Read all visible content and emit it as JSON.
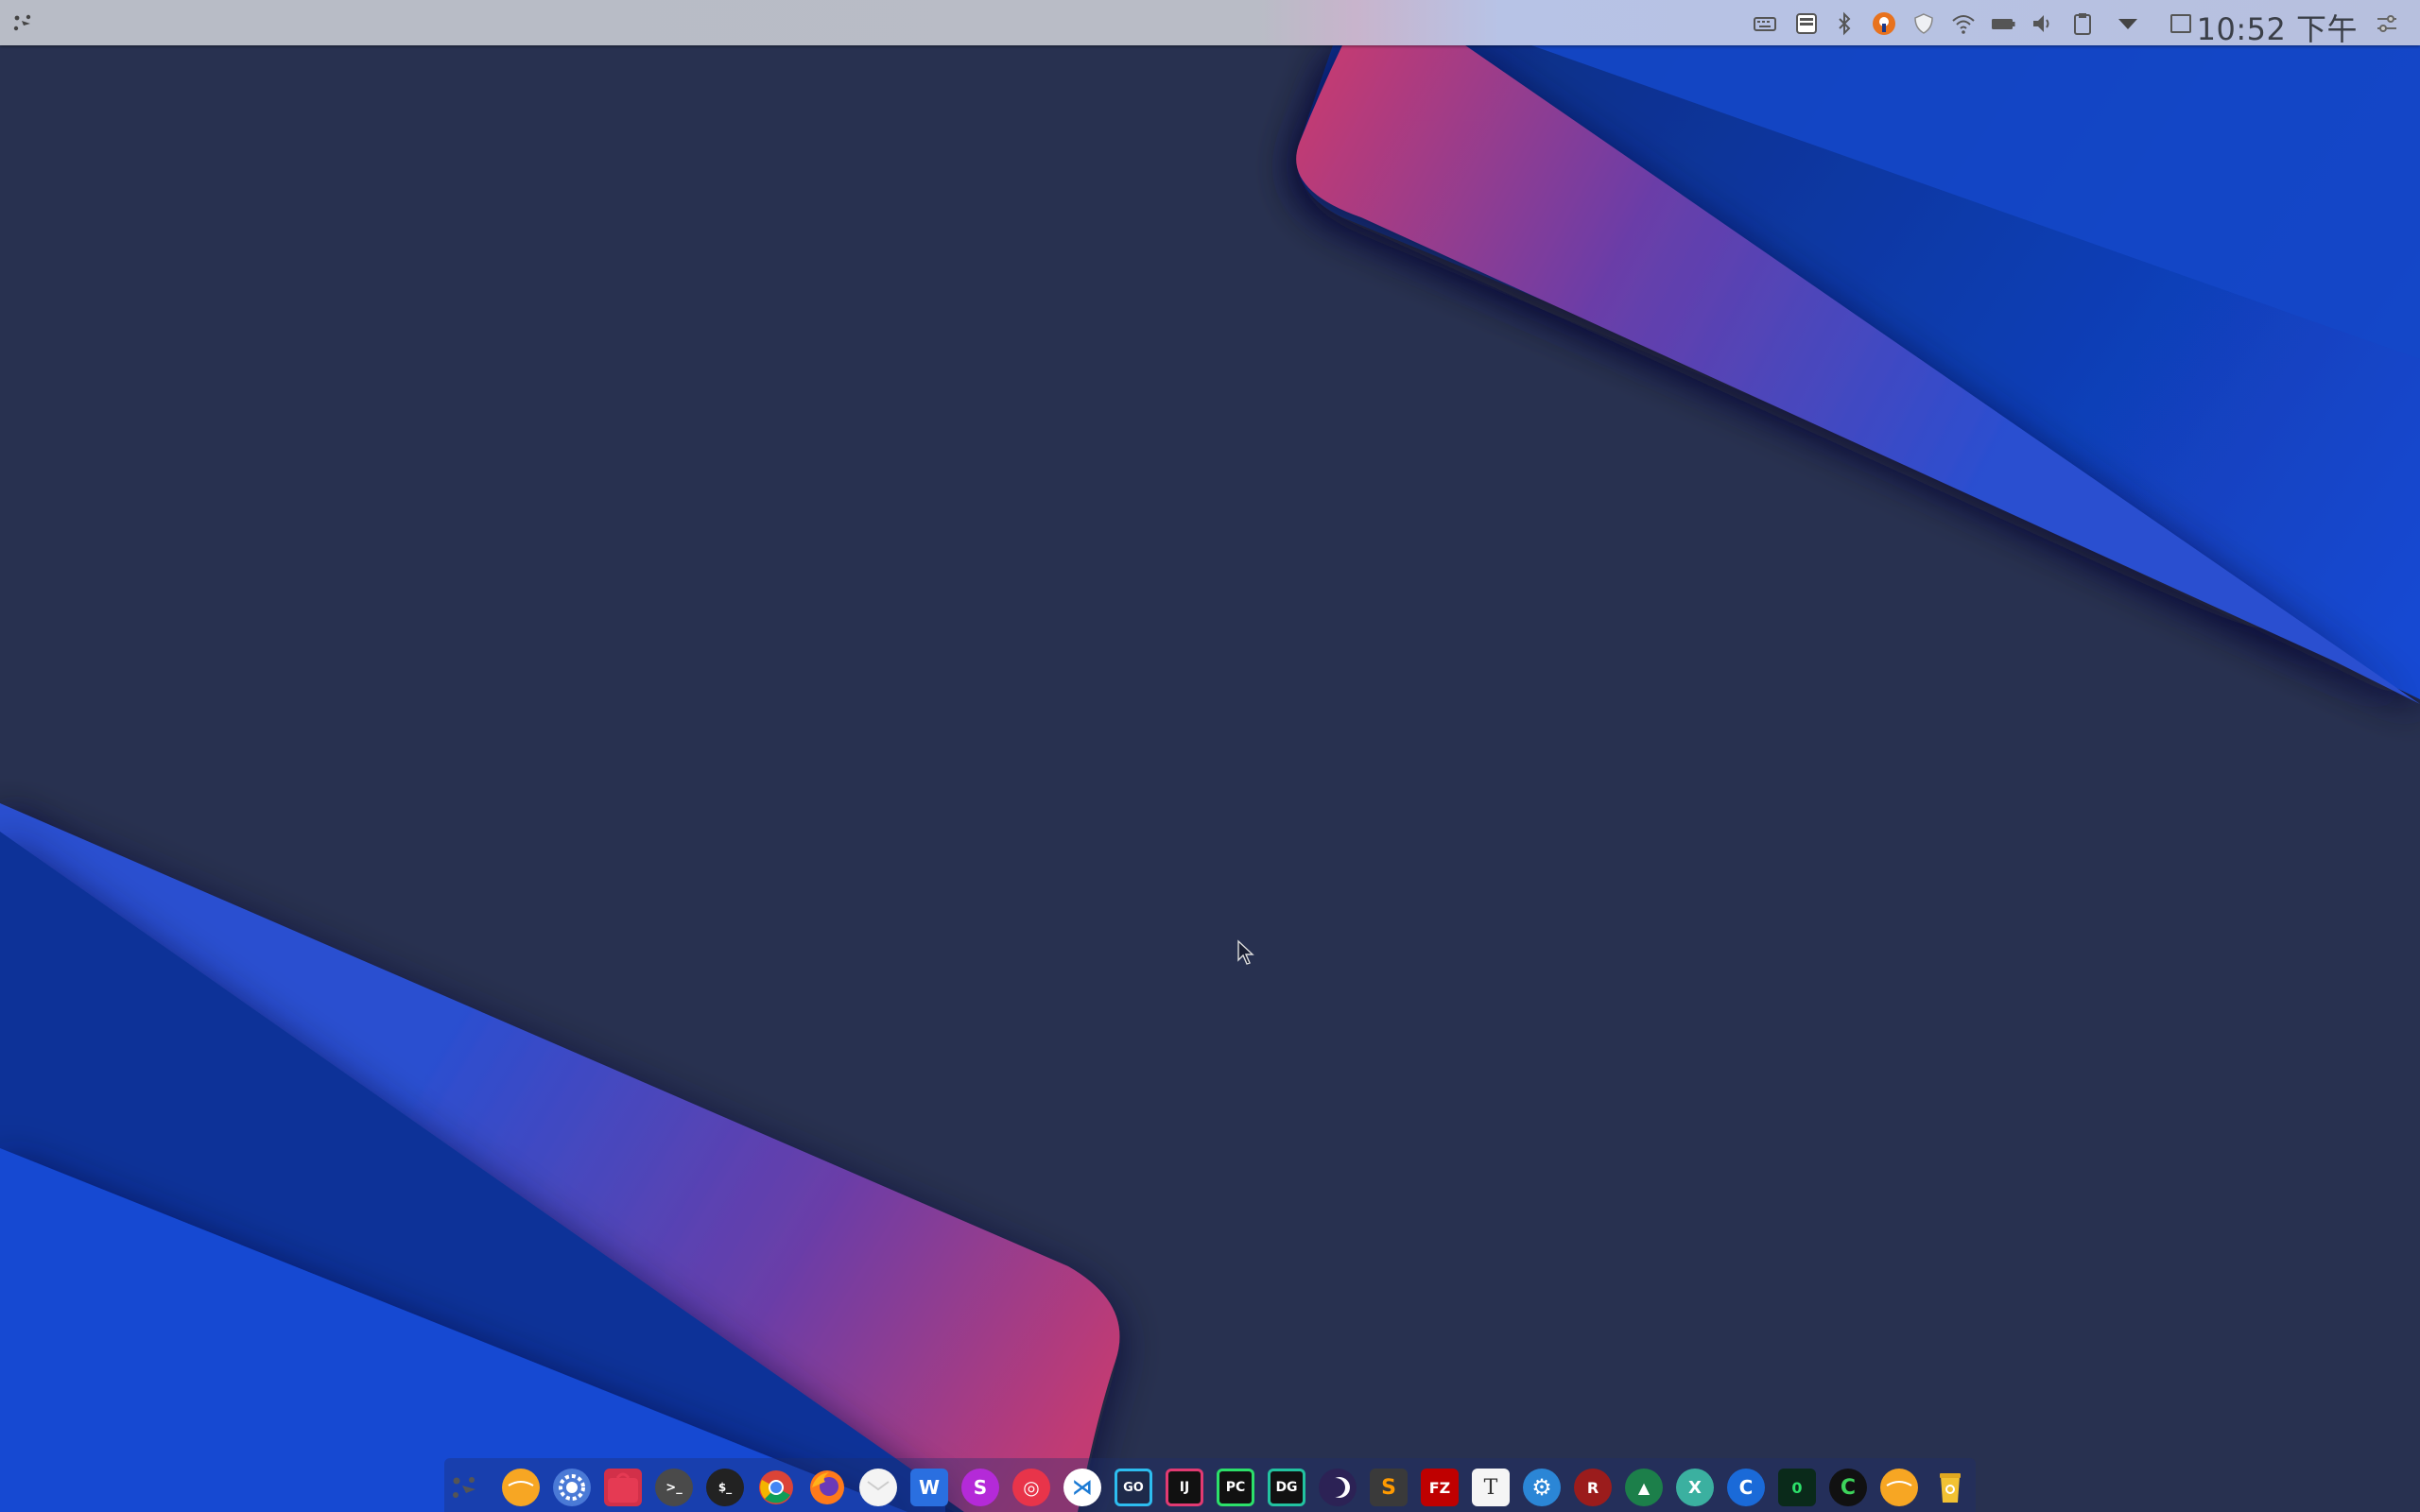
{
  "topbar": {
    "clock": "10:52 下午"
  },
  "tray_icons": [
    "keyboard-icon",
    "inbox-icon",
    "bluetooth-icon",
    "vpn-key-icon",
    "shield-icon",
    "wifi-icon",
    "battery-icon",
    "volume-icon",
    "clipboard-icon",
    "dropdown-arrow-icon",
    "show-desktop-icon",
    "settings-toggle-icon"
  ],
  "dock": {
    "apps": [
      {
        "name": "launcher",
        "label": ""
      },
      {
        "name": "files",
        "label": ""
      },
      {
        "name": "settings",
        "label": ""
      },
      {
        "name": "app-store",
        "label": ""
      },
      {
        "name": "terminal",
        "label": ">_"
      },
      {
        "name": "terminal-2",
        "label": "$_"
      },
      {
        "name": "chrome",
        "label": ""
      },
      {
        "name": "firefox",
        "label": ""
      },
      {
        "name": "mail",
        "label": ""
      },
      {
        "name": "wps",
        "label": "W"
      },
      {
        "name": "sublime-merge",
        "label": "S"
      },
      {
        "name": "netease-music",
        "label": "◎"
      },
      {
        "name": "vscode",
        "label": "⋊"
      },
      {
        "name": "goland",
        "label": "GO"
      },
      {
        "name": "intellij",
        "label": "IJ"
      },
      {
        "name": "pycharm",
        "label": "PC"
      },
      {
        "name": "datagrip",
        "label": "DG"
      },
      {
        "name": "eclipse",
        "label": ""
      },
      {
        "name": "sublime-text",
        "label": "S"
      },
      {
        "name": "filezilla",
        "label": "FZ"
      },
      {
        "name": "typora",
        "label": "T"
      },
      {
        "name": "preferences",
        "label": "⚙"
      },
      {
        "name": "redis-desktop",
        "label": "R"
      },
      {
        "name": "rocket",
        "label": "▲"
      },
      {
        "name": "xmind",
        "label": "X"
      },
      {
        "name": "cloud-client",
        "label": "C"
      },
      {
        "name": "system-monitor",
        "label": "0"
      },
      {
        "name": "qbittorrent",
        "label": "C"
      },
      {
        "name": "files-2",
        "label": ""
      },
      {
        "name": "trash",
        "label": ""
      }
    ]
  },
  "colors": {
    "background": "#283150",
    "ribbon_blue": "#1246c8",
    "ribbon_pink": "#c03a78",
    "ribbon_purple": "#5a3fb0"
  }
}
